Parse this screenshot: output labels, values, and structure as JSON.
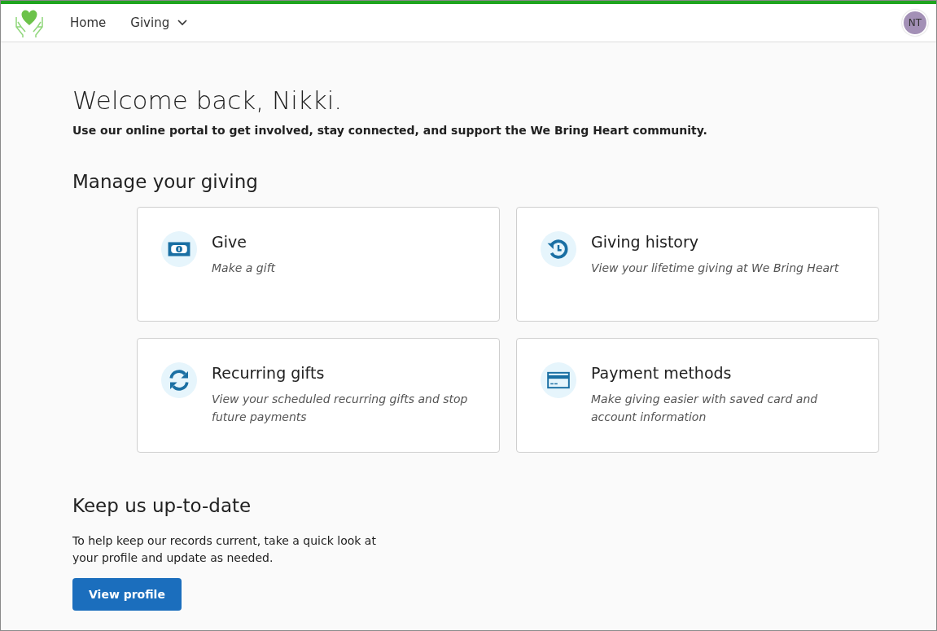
{
  "nav": {
    "items": [
      {
        "label": "Home",
        "kind": "link"
      },
      {
        "label": "Giving",
        "kind": "dropdown"
      }
    ],
    "avatar": "NT"
  },
  "welcome": {
    "title": "Welcome back, Nikki.",
    "intro": "Use our online portal to get involved, stay connected, and support the We Bring Heart community."
  },
  "giving": {
    "heading": "Manage your giving",
    "cards": [
      {
        "kind": "money",
        "title": "Give",
        "description": "Make a gift"
      },
      {
        "kind": "history",
        "title": "Giving history",
        "description": "View your lifetime giving at We Bring Heart"
      },
      {
        "kind": "recurring",
        "title": "Recurring gifts",
        "description": "View your scheduled recurring gifts and stop future payments"
      },
      {
        "kind": "card",
        "title": "Payment methods",
        "description": "Make giving easier with saved card and account information"
      }
    ]
  },
  "profile": {
    "heading": "Keep us up-to-date",
    "text": "To help keep our records current, take a quick look at your profile and update as needed.",
    "button": "View profile"
  }
}
